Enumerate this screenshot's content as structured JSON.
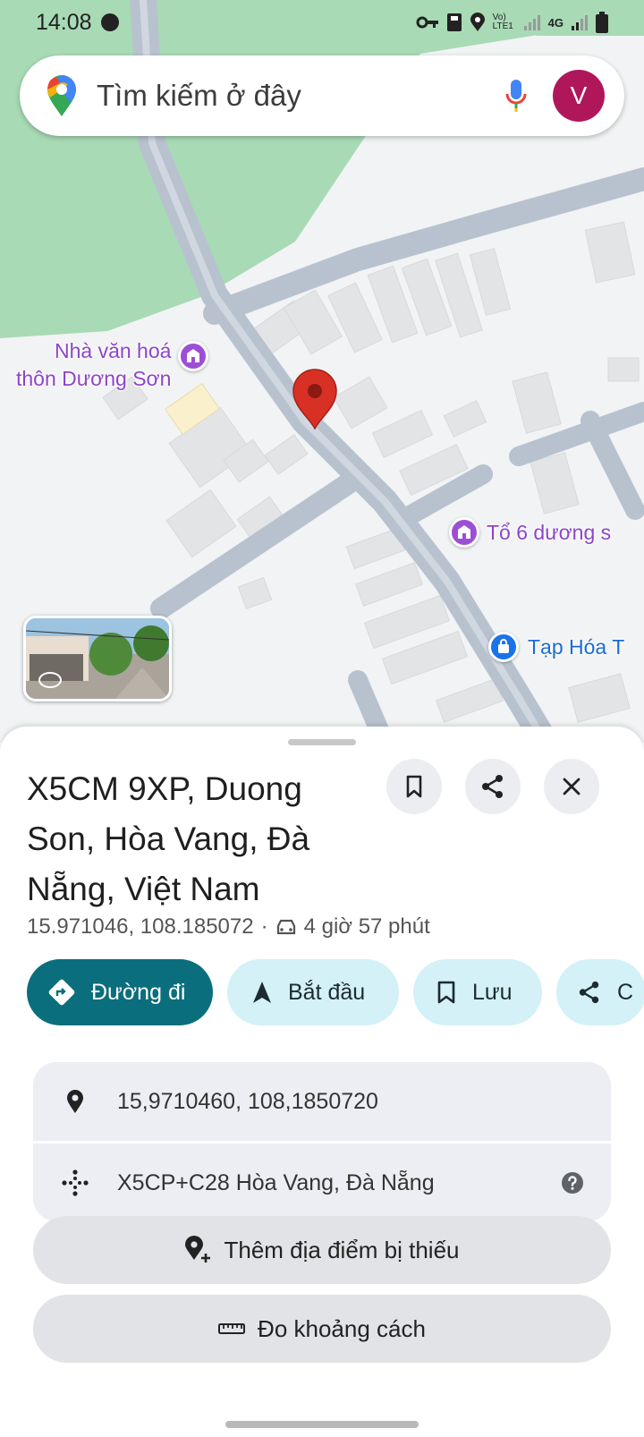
{
  "status_bar": {
    "time": "14:08",
    "network_label": "Vo) LTE1",
    "network_4g": "4G"
  },
  "search": {
    "placeholder": "Tìm kiếm ở đây",
    "avatar_letter": "V"
  },
  "map": {
    "pois": [
      {
        "label_line1": "Nhà văn hoá",
        "label_line2": "thôn Dương Sơn",
        "type": "community-hall",
        "color": "#9c4fd6"
      },
      {
        "label": "Tổ 6 dương s",
        "type": "community-hall",
        "color": "#9c4fd6"
      },
      {
        "label": "Tạp Hóa T",
        "type": "shop",
        "color": "#1a73e8"
      }
    ],
    "marker_color": "#d93025"
  },
  "place": {
    "title": "X5CM 9XP, Duong Son, Hòa Vang, Đà Nẵng, Việt Nam",
    "coordinates": "15.971046, 108.185072",
    "separator": "·",
    "drive_time": "4 giờ 57 phút"
  },
  "actions": [
    {
      "label": "Đường đi",
      "icon": "directions-icon",
      "style": "primary"
    },
    {
      "label": "Bắt đầu",
      "icon": "navigation-arrow-icon",
      "style": "secondary"
    },
    {
      "label": "Lưu",
      "icon": "bookmark-icon",
      "style": "secondary"
    },
    {
      "label": "C",
      "icon": "share-icon",
      "style": "secondary"
    }
  ],
  "details": {
    "coords_row": "15,9710460, 108,1850720",
    "plus_code_row": "X5CP+C28 Hòa Vang, Đà Nẵng"
  },
  "buttons": {
    "add_missing_place": "Thêm địa điểm bị thiếu",
    "measure_distance": "Đo khoảng cách"
  },
  "colors": {
    "primary_teal": "#0b6e7d",
    "chip_light": "#d3f1f7",
    "avatar": "#b0175a",
    "park_green": "#a8dab5"
  }
}
